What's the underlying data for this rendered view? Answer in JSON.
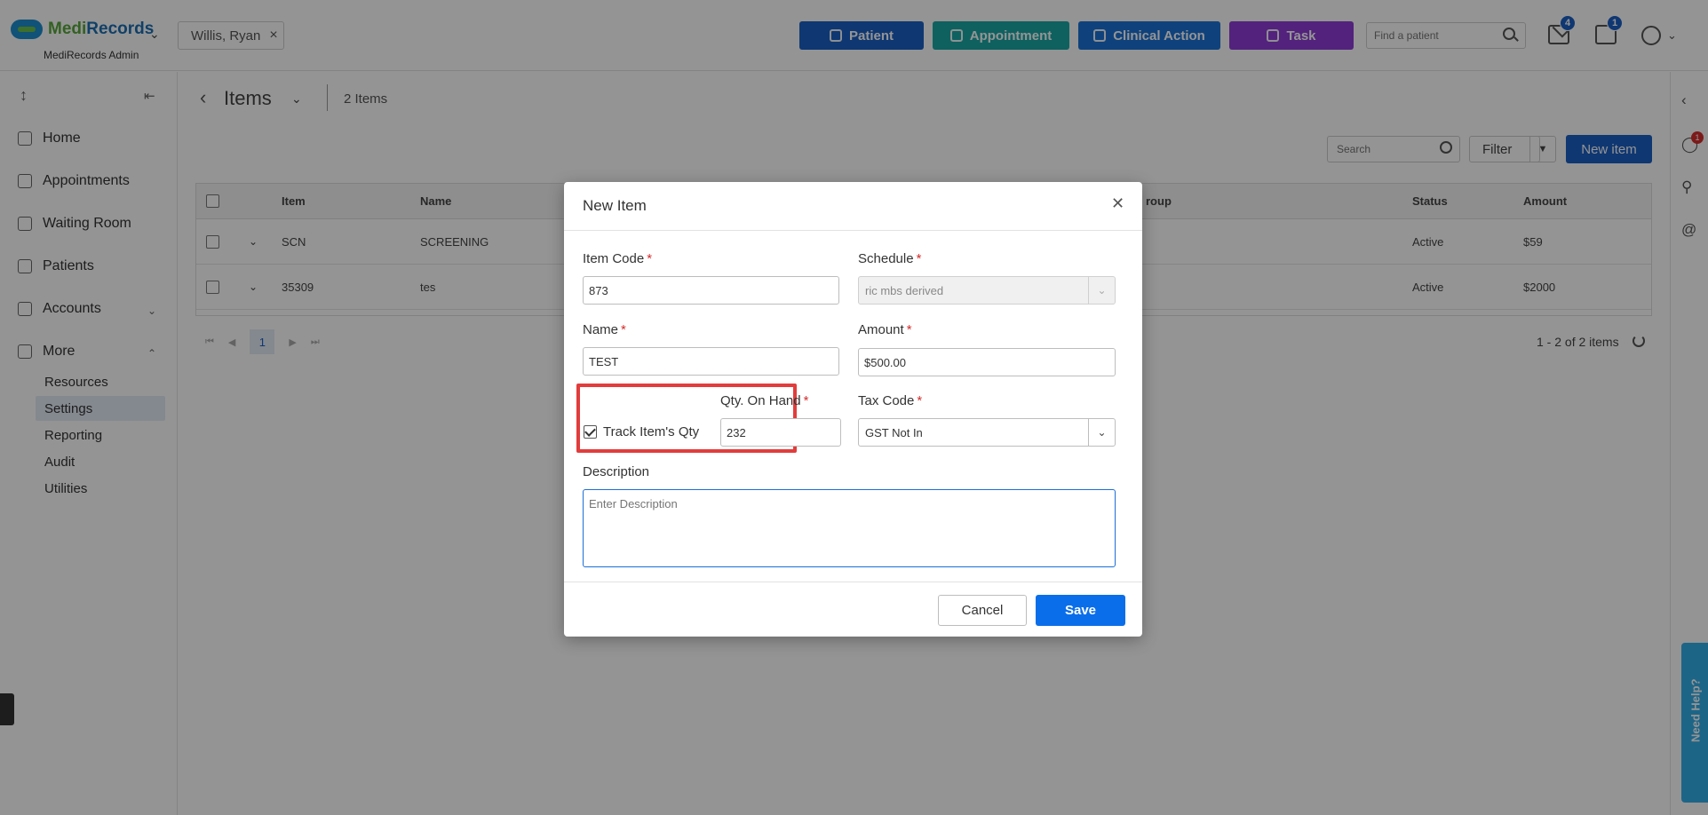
{
  "app": {
    "brand_part1": "Medi",
    "brand_part2": "Records",
    "subtitle": "MediRecords Admin",
    "patient_chip": "Willis, Ryan",
    "actions": [
      "Patient",
      "Appointment",
      "Clinical Action",
      "Task"
    ],
    "find_patient_placeholder": "Find a patient",
    "mail_badge": "4",
    "calendar_badge": "1"
  },
  "sidebar": {
    "items": [
      {
        "label": "Home"
      },
      {
        "label": "Appointments"
      },
      {
        "label": "Waiting Room"
      },
      {
        "label": "Patients"
      },
      {
        "label": "Accounts"
      },
      {
        "label": "More"
      }
    ],
    "sub_items": [
      {
        "label": "Resources"
      },
      {
        "label": "Settings"
      },
      {
        "label": "Reporting"
      },
      {
        "label": "Audit"
      },
      {
        "label": "Utilities"
      }
    ]
  },
  "main": {
    "title": "Items",
    "count": "2 Items",
    "search_placeholder": "Search",
    "filter_label": "Filter",
    "new_item_label": "New item",
    "columns": [
      "Item",
      "Name",
      "roup",
      "Status",
      "Amount"
    ],
    "rows": [
      {
        "item": "SCN",
        "name": "SCREENING",
        "status": "Active",
        "amount": "$59"
      },
      {
        "item": "35309",
        "name": "tes",
        "status": "Active",
        "amount": "$2000"
      }
    ],
    "page": "1",
    "pager_info": "1 - 2 of 2 items"
  },
  "rail": {
    "notification_badge": "1",
    "help_label": "Need Help?"
  },
  "modal": {
    "title": "New Item",
    "item_code_label": "Item Code",
    "item_code_value": "873",
    "schedule_label": "Schedule",
    "schedule_value": "ric mbs derived",
    "name_label": "Name",
    "name_value": "TEST",
    "amount_label": "Amount",
    "amount_value": "$500.00",
    "track_label": "Track Item's Qty",
    "qty_label": "Qty. On Hand",
    "qty_value": "232",
    "tax_code_label": "Tax Code",
    "tax_code_value": "GST Not In",
    "description_label": "Description",
    "description_placeholder": "Enter Description",
    "required_mark": "*",
    "cancel_label": "Cancel",
    "save_label": "Save"
  },
  "colors": {
    "primary": "#1b5fc4",
    "appointment": "#1aa7a6",
    "clinical": "#1b72d6",
    "task": "#8e3bd8",
    "highlight": "#e23c3c",
    "save": "#0a6eea"
  }
}
